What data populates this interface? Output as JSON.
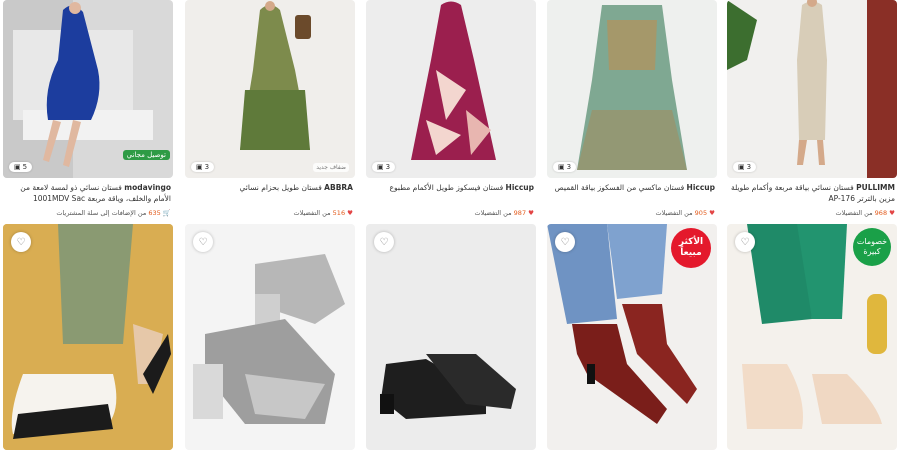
{
  "row1": [
    {
      "title_brand": "modavingo",
      "title_text": "فستان نسائي ذو لمسة لامعة من الأمام والخلف، وياقة مربعة 1001MDV Sac",
      "count": "5",
      "rating_count": "635",
      "meta_text": "من الإضافات إلى سلة المشتريات",
      "extra_badge": "توصيل مجاني",
      "brand_tag": ""
    },
    {
      "title_brand": "ABBRA",
      "title_text": "فستان طويل بحزام نسائي",
      "count": "3",
      "rating_count": "516",
      "meta_text": "من التفضيلات",
      "extra_badge": "",
      "brand_tag": "ضفاف جديد"
    },
    {
      "title_brand": "Hiccup",
      "title_text": "فستان فيسكوز طويل الأكمام مطبوع",
      "count": "3",
      "rating_count": "987",
      "meta_text": "من التفضيلات",
      "extra_badge": "",
      "brand_tag": ""
    },
    {
      "title_brand": "Hiccup",
      "title_text": "فستان ماكسي من الفسكوز بياقة القميص",
      "count": "3",
      "rating_count": "905",
      "meta_text": "من التفضيلات",
      "extra_badge": "",
      "brand_tag": ""
    },
    {
      "title_brand": "PULLIMM",
      "title_text": "فستان نسائي بياقة مربعة وأكمام طويلة مزين بالترتر AP-176",
      "count": "3",
      "rating_count": "968",
      "meta_text": "من التفضيلات",
      "extra_badge": "",
      "brand_tag": ""
    }
  ],
  "row2": [
    {
      "wish_icon": "heart-outline-icon",
      "label": ""
    },
    {
      "wish_icon": "heart-outline-icon",
      "label": ""
    },
    {
      "wish_icon": "heart-outline-icon",
      "label": ""
    },
    {
      "wish_icon": "heart-outline-icon",
      "label": "الأكثر مبيعاً"
    },
    {
      "wish_icon": "heart-outline-icon",
      "label": "خصومات كبيرة"
    }
  ],
  "colors": {
    "orange": "#e35b1c",
    "green_badge": "#2e9b45",
    "red_badge": "#e4192c"
  }
}
